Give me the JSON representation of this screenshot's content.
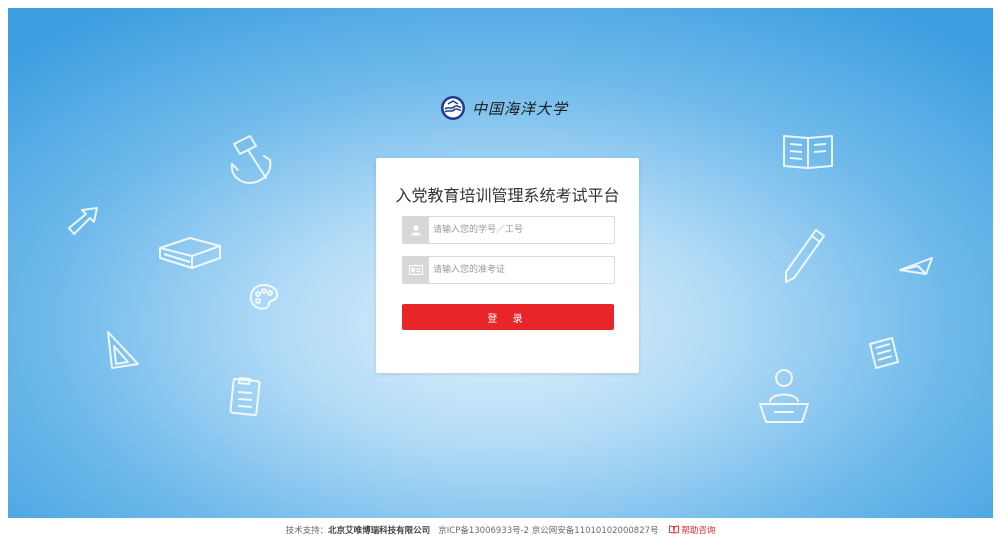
{
  "colors": {
    "accent": "#e8262a",
    "background_center": "#e0f1fd",
    "background_edge": "#3d9ee0"
  },
  "header": {
    "logo_text": "中国海洋大学",
    "logo_icon": "university-emblem-icon"
  },
  "login_card": {
    "title": "入党教育培训管理系统考试平台",
    "username_field": {
      "icon": "user-icon",
      "placeholder": "请输入您的学号／工号",
      "value": ""
    },
    "ticket_field": {
      "icon": "id-card-icon",
      "placeholder": "请输入您的准考证",
      "value": ""
    },
    "login_button": "登 录"
  },
  "footer": {
    "support_label": "技术支持：",
    "support_company": "北京艾唯博瑞科技有限公司",
    "icp": "京ICP备13006933号-2",
    "police_record": "京公网安备11010102000827号",
    "help_icon": "book-icon",
    "help_label": "帮助咨询"
  },
  "decorations": [
    "hammer-sickle-icon",
    "arrow-icon",
    "book-icon",
    "palette-icon",
    "triangle-ruler-icon",
    "clipboard-icon",
    "open-book-icon",
    "pencil-icon",
    "paper-plane-icon",
    "notebook-icon",
    "teacher-icon"
  ]
}
